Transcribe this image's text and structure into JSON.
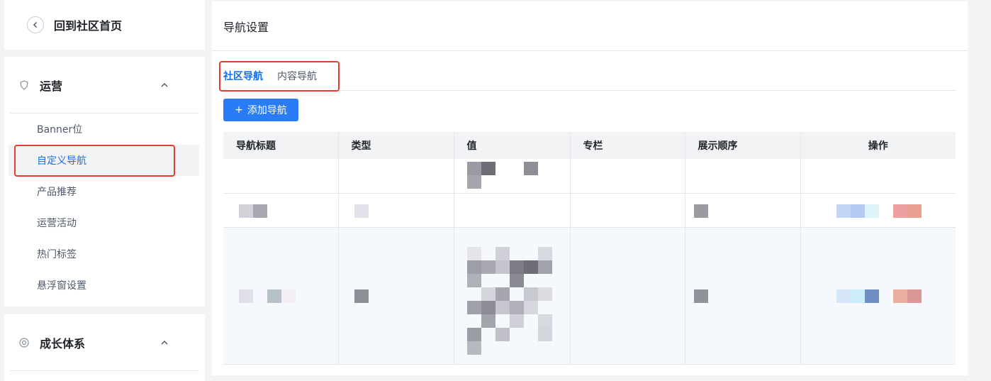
{
  "back": {
    "title": "回到社区首页"
  },
  "sidebar": {
    "groups": [
      {
        "label": "运营",
        "items": [
          {
            "label": "Banner位"
          },
          {
            "label": "自定义导航"
          },
          {
            "label": "产品推荐"
          },
          {
            "label": "运营活动"
          },
          {
            "label": "热门标签"
          },
          {
            "label": "悬浮窗设置"
          }
        ]
      },
      {
        "label": "成长体系"
      }
    ]
  },
  "main": {
    "title": "导航设置",
    "tabs": [
      {
        "label": "社区导航"
      },
      {
        "label": "内容导航"
      }
    ],
    "add_button": "添加导航",
    "table": {
      "columns": [
        "导航标题",
        "类型",
        "值",
        "专栏",
        "展示顺序",
        "操作"
      ]
    }
  },
  "colors": {
    "accent": "#2a7cf6",
    "highlight": "#e63b2e",
    "active_text": "#1a6fe0"
  }
}
